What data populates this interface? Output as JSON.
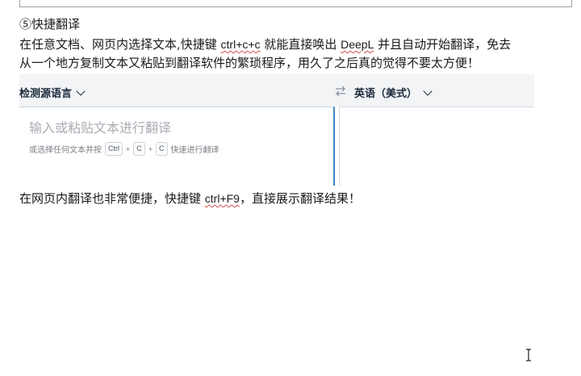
{
  "doc": {
    "heading": "⑤快捷翻译",
    "para1": {
      "before": "在任意文档、网页内选择文本,快捷键 ",
      "shortcut": "ctrl+c+c",
      "middle": " 就能直接唤出 ",
      "app": "DeepL",
      "after": " 并且自动开始翻译，免去"
    },
    "para2": "从一个地方复制文本又粘贴到翻译软件的繁琐程序，用久了之后真的觉得不要太方便！",
    "para3": {
      "before": "在网页内翻译也非常便捷，快捷键 ",
      "shortcut": "ctrl+F9",
      "after": "，直接展示翻译结果！"
    }
  },
  "translator": {
    "source_lang": "检测源语言",
    "target_lang": "英语（美式）",
    "placeholder": "输入或粘贴文本进行翻译",
    "hint_prefix": "或选择任何文本并按",
    "keys": [
      "Ctrl",
      "C",
      "C"
    ],
    "plus": "+",
    "hint_suffix": "快速进行翻译"
  },
  "colors": {
    "spell_underline": "#d05050",
    "panel_focus_border": "#3b86c8",
    "toolbar_bg": "#f2f4f6"
  }
}
